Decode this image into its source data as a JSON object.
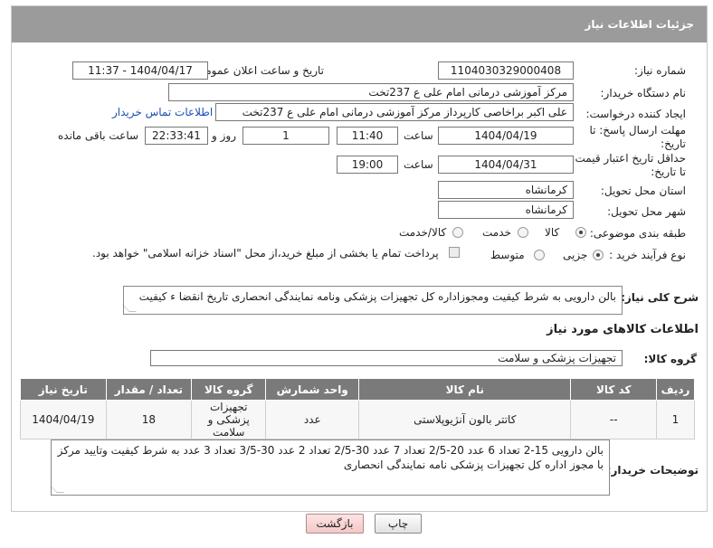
{
  "header": {
    "title": "جزئیات اطلاعات نیاز"
  },
  "fields": {
    "need_number_label": "شماره نیاز:",
    "need_number": "1104030329000408",
    "announce_label": "تاریخ و ساعت اعلان عمومی:",
    "announce_value": "1404/04/17 - 11:37",
    "buyer_org_label": "نام دستگاه خریدار:",
    "buyer_org": "مرکز آموزشی درمانی امام علی ع 237تخت",
    "creator_label": "ایجاد کننده درخواست:",
    "creator": "علی اکبر براخاصی کارپرداز  مرکز آموزشی درمانی امام علی ع 237تخت",
    "contact_link": "اطلاعات تماس خریدار",
    "deadline_label": "مهلت ارسال پاسخ: تا تاریخ:",
    "deadline_date": "1404/04/19",
    "time_label": "ساعت",
    "deadline_time": "11:40",
    "days_value": "1",
    "days_label": "روز و",
    "remaining_time": "22:33:41",
    "remaining_label": "ساعت باقی مانده",
    "price_validity_label": "حداقل تاریخ اعتبار قیمت: تا تاریخ:",
    "price_validity_date": "1404/04/31",
    "price_validity_time": "19:00",
    "province_label": "استان محل تحویل:",
    "province": "کرمانشاه",
    "city_label": "شهر محل تحویل:",
    "city": "کرمانشاه",
    "category_label": "طبقه بندی موضوعی:",
    "category_options": [
      "کالا",
      "خدمت",
      "کالا/خدمت"
    ],
    "process_label": "نوع فرآیند خرید :",
    "process_options": [
      "جزیی",
      "متوسط"
    ],
    "payment_note": "پرداخت تمام یا بخشی از مبلغ خرید،از محل \"اسناد خزانه اسلامی\" خواهد بود.",
    "general_desc_label": "شرح کلی نیاز:",
    "general_desc": "بالن دارویی به شرط کیفیت ومجوزاداره کل تجهیزات پزشکی ونامه نمایندگی انحصاری تاریخ انقضا ء کیفیت"
  },
  "goods": {
    "section_title": "اطلاعات کالاهای مورد نیاز",
    "group_label": "گروه کالا:",
    "group_value": "تجهیزات پزشکی و سلامت",
    "columns": [
      "ردیف",
      "کد کالا",
      "نام کالا",
      "واحد شمارش",
      "گروه کالا",
      "تعداد / مقدار",
      "تاریخ نیاز"
    ],
    "rows": [
      [
        "1",
        "--",
        "کاتتر بالون آنژیوپلاستی",
        "عدد",
        "تجهیزات پزشکی و سلامت",
        "18",
        "1404/04/19"
      ]
    ]
  },
  "buyer_notes": {
    "label": "توضیحات خریدار:",
    "text": "بالن دارویی 15-2 تعداد  6 عدد 20-2/5 تعداد 7 عدد 30-2/5 تعداد 2 عدد 30-3/5 تعداد 3 عدد  به شرط کیفیت وتایید مرکز با مجوز اداره کل تجهیزات پزشکی نامه نمایندگی انحصاری"
  },
  "actions": {
    "print": "چاپ",
    "back": "بازگشت"
  },
  "colors": {
    "header_bg": "#9b9b9b",
    "table_header_bg": "#7a7a7a",
    "link": "#1a4fb3"
  }
}
